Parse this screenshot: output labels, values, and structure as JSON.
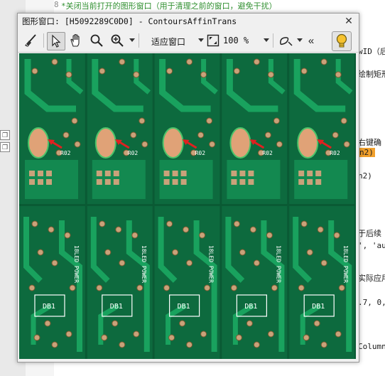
{
  "editor": {
    "line_number": "8",
    "line8_text": "*关闭当前打开的图形窗口（用于清理之前的窗口，避免干扰）",
    "right_fragments": [
      "wID（后",
      "绘制矩形",
      "右键确",
      "n2)",
      "n2)",
      "于后续",
      "', 'au",
      "实际应用",
      ".7, 0,",
      "Column"
    ]
  },
  "window": {
    "title": "图形窗口: [H5092289C0D0] - ContoursAffinTrans",
    "close_glyph": "✕"
  },
  "toolbar": {
    "zoom_mode": "适应窗口",
    "zoom_percent": "100 %",
    "more_glyph": "«"
  },
  "canvas": {
    "board_labels": [
      "DB1",
      "DB1",
      "DB1",
      "DB1",
      "DB1"
    ],
    "rail_labels": [
      "18LED POWER",
      "18LED POWER",
      "18LED POWER",
      "18LED POWER",
      "18LED POWER"
    ],
    "component_label": "R02",
    "colors": {
      "board": "#0d6a3e",
      "trace": "#19a25e",
      "pad": "#c9a27a",
      "ellipse_pad": "#e0a277",
      "arrow": "#e02020"
    }
  },
  "colors": {
    "accent": "#f1a02c",
    "title_bg": "#f0f0f0"
  }
}
